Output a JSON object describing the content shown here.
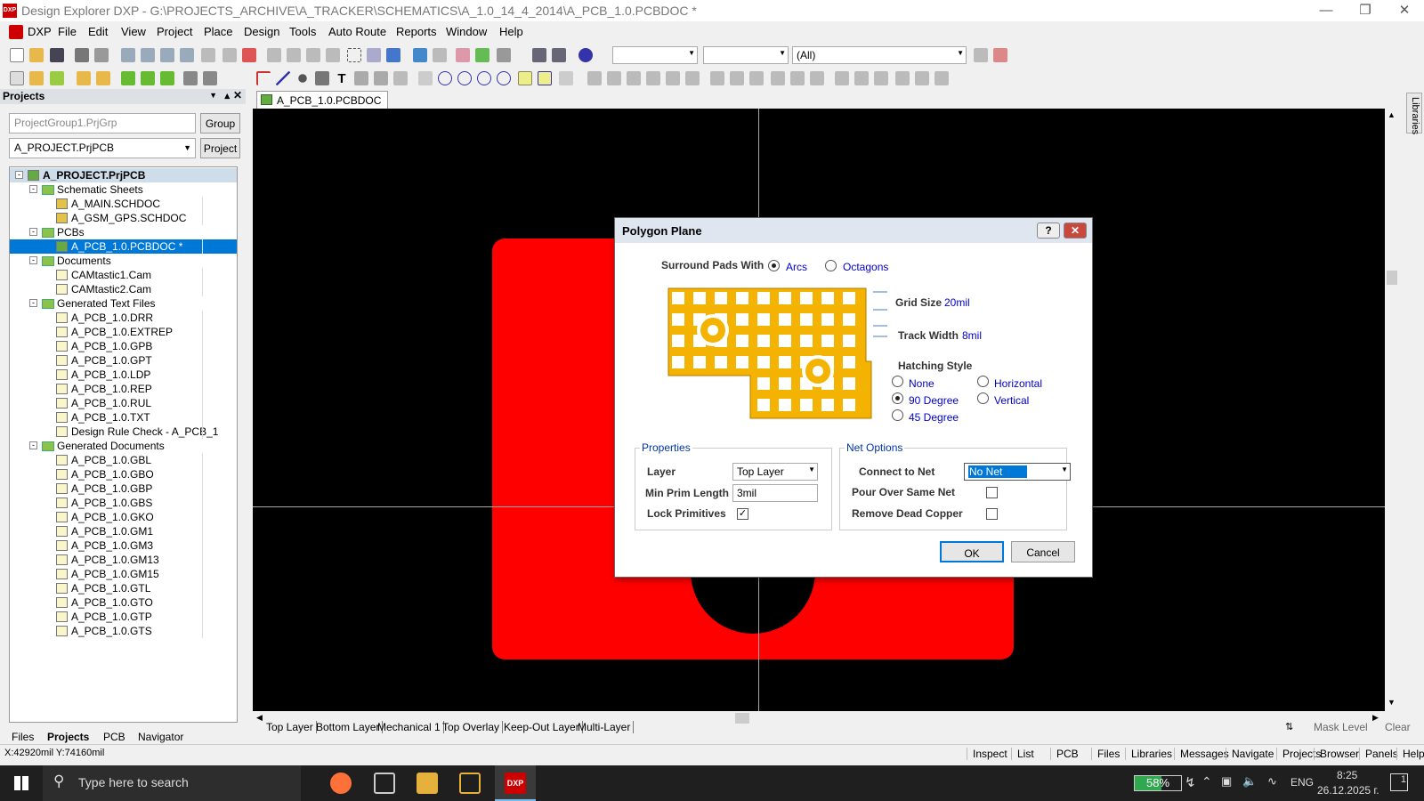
{
  "app": {
    "title": "Design Explorer DXP - G:\\PROJECTS_ARCHIVE\\A_TRACKER\\SCHEMATICS\\A_1.0_14_4_2014\\A_PCB_1.0.PCBDOC *",
    "icon": "DXP"
  },
  "menu": [
    "DXP",
    "File",
    "Edit",
    "View",
    "Project",
    "Place",
    "Design",
    "Tools",
    "Auto Route",
    "Reports",
    "Window",
    "Help"
  ],
  "toolbar": {
    "filter_value": "(All)"
  },
  "projects_panel": {
    "title": "Projects",
    "group_field": "ProjectGroup1.PrjGrp",
    "group_button": "Group",
    "project_combo": "A_PROJECT.PrjPCB",
    "project_button": "Project",
    "tree": [
      {
        "label": "A_PROJECT.PrjPCB",
        "level": 0,
        "kind": "project",
        "bold": true
      },
      {
        "label": "Schematic Sheets",
        "level": 1,
        "kind": "folder"
      },
      {
        "label": "A_MAIN.SCHDOC",
        "level": 2,
        "kind": "sch"
      },
      {
        "label": "A_GSM_GPS.SCHDOC",
        "level": 2,
        "kind": "sch"
      },
      {
        "label": "PCBs",
        "level": 1,
        "kind": "folder"
      },
      {
        "label": "A_PCB_1.0.PCBDOC *",
        "level": 2,
        "kind": "pcb",
        "selected": true
      },
      {
        "label": "Documents",
        "level": 1,
        "kind": "folder"
      },
      {
        "label": "CAMtastic1.Cam",
        "level": 2,
        "kind": "file"
      },
      {
        "label": "CAMtastic2.Cam",
        "level": 2,
        "kind": "file"
      },
      {
        "label": "Generated Text Files",
        "level": 1,
        "kind": "folder"
      },
      {
        "label": "A_PCB_1.0.DRR",
        "level": 2,
        "kind": "file"
      },
      {
        "label": "A_PCB_1.0.EXTREP",
        "level": 2,
        "kind": "file"
      },
      {
        "label": "A_PCB_1.0.GPB",
        "level": 2,
        "kind": "file"
      },
      {
        "label": "A_PCB_1.0.GPT",
        "level": 2,
        "kind": "file"
      },
      {
        "label": "A_PCB_1.0.LDP",
        "level": 2,
        "kind": "file"
      },
      {
        "label": "A_PCB_1.0.REP",
        "level": 2,
        "kind": "file"
      },
      {
        "label": "A_PCB_1.0.RUL",
        "level": 2,
        "kind": "file"
      },
      {
        "label": "A_PCB_1.0.TXT",
        "level": 2,
        "kind": "file"
      },
      {
        "label": "Design Rule Check - A_PCB_1",
        "level": 2,
        "kind": "file"
      },
      {
        "label": "Generated Documents",
        "level": 1,
        "kind": "folder"
      },
      {
        "label": "A_PCB_1.0.GBL",
        "level": 2,
        "kind": "file"
      },
      {
        "label": "A_PCB_1.0.GBO",
        "level": 2,
        "kind": "file"
      },
      {
        "label": "A_PCB_1.0.GBP",
        "level": 2,
        "kind": "file"
      },
      {
        "label": "A_PCB_1.0.GBS",
        "level": 2,
        "kind": "file"
      },
      {
        "label": "A_PCB_1.0.GKO",
        "level": 2,
        "kind": "file"
      },
      {
        "label": "A_PCB_1.0.GM1",
        "level": 2,
        "kind": "file"
      },
      {
        "label": "A_PCB_1.0.GM3",
        "level": 2,
        "kind": "file"
      },
      {
        "label": "A_PCB_1.0.GM13",
        "level": 2,
        "kind": "file"
      },
      {
        "label": "A_PCB_1.0.GM15",
        "level": 2,
        "kind": "file"
      },
      {
        "label": "A_PCB_1.0.GTL",
        "level": 2,
        "kind": "file"
      },
      {
        "label": "A_PCB_1.0.GTO",
        "level": 2,
        "kind": "file"
      },
      {
        "label": "A_PCB_1.0.GTP",
        "level": 2,
        "kind": "file"
      },
      {
        "label": "A_PCB_1.0.GTS",
        "level": 2,
        "kind": "file"
      }
    ],
    "bottom_tabs": [
      "Files",
      "Projects",
      "PCB",
      "Navigator"
    ]
  },
  "document_tab": "A_PCB_1.0.PCBDOC *",
  "side_panel": "Libraries",
  "dialog": {
    "title": "Polygon Plane",
    "help_label": "?",
    "surround_label": "Surround Pads With",
    "surround_options": [
      "Arcs",
      "Octagons"
    ],
    "surround_selected": "Arcs",
    "grid_size_label": "Grid Size",
    "grid_size_value": "20mil",
    "track_width_label": "Track Width",
    "track_width_value": "8mil",
    "hatching_label": "Hatching Style",
    "hatching_options": [
      "None",
      "Horizontal",
      "90 Degree",
      "Vertical",
      "45 Degree"
    ],
    "hatching_selected": "90 Degree",
    "properties_label": "Properties",
    "layer_label": "Layer",
    "layer_value": "Top Layer",
    "min_prim_label": "Min Prim Length",
    "min_prim_value": "3mil",
    "lock_label": "Lock Primitives",
    "lock_checked": true,
    "net_options_label": "Net Options",
    "connect_label": "Connect to Net",
    "connect_value": "No Net",
    "pour_label": "Pour Over Same Net",
    "pour_checked": false,
    "remove_label": "Remove Dead Copper",
    "remove_checked": false,
    "ok_label": "OK",
    "cancel_label": "Cancel"
  },
  "layer_tabs": [
    "Top Layer",
    "Bottom Layer",
    "Mechanical 1",
    "Top Overlay",
    "Keep-Out Layer",
    "Multi-Layer"
  ],
  "layer_right": {
    "mask": "Mask Level",
    "clear": "Clear"
  },
  "status": {
    "coords": "X:42920mil Y:74160mil",
    "buttons": [
      "Inspect",
      "List",
      "PCB",
      "Files",
      "Libraries",
      "Messages",
      "Navigate",
      "Projects",
      "Browser",
      "Panels",
      "Help"
    ]
  },
  "taskbar": {
    "search_placeholder": "Type here to search",
    "battery": "58%",
    "lang": "ENG",
    "time": "8:25",
    "date": "26.12.2025 г.",
    "notifications": "1"
  },
  "colors": {
    "polygon": "#ff0000",
    "canvas": "#000000",
    "selection": "#0078d7",
    "preview": "#f5b301"
  }
}
